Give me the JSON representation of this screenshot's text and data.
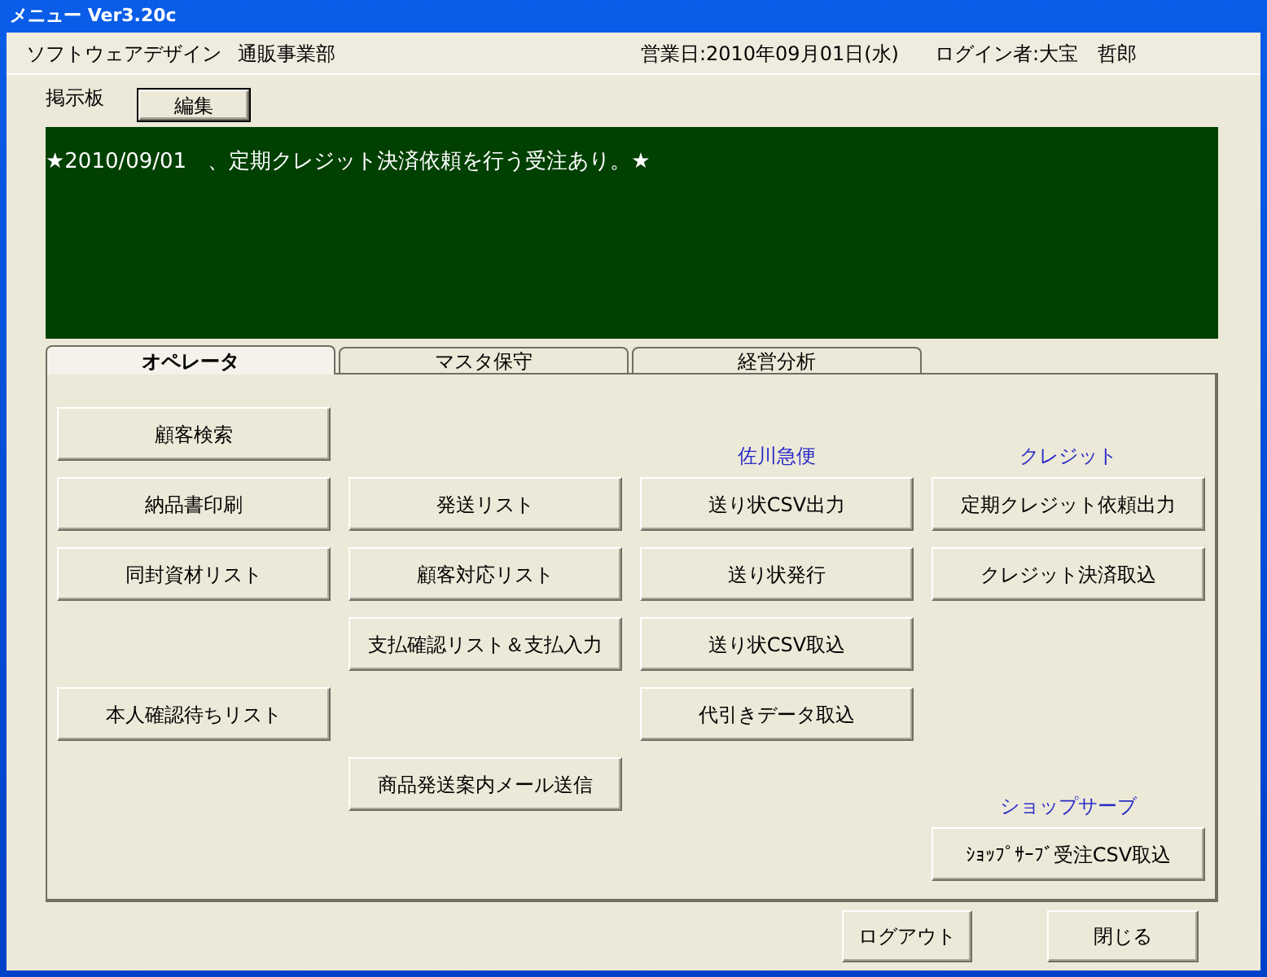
{
  "window": {
    "title": "メニュー Ver3.20c"
  },
  "header": {
    "company": "ソフトウェアデザイン",
    "department": "通販事業部",
    "business_date": "営業日:2010年09月01日(水)",
    "login_user": "ログイン者:大宝　哲郎"
  },
  "bulletin": {
    "label": "掲示板",
    "edit_button": "編集",
    "message": "★2010/09/01　、定期クレジット決済依頼を行う受注あり。★"
  },
  "tabs": [
    {
      "label": "オペレータ",
      "selected": true
    },
    {
      "label": "マスタ保守",
      "selected": false
    },
    {
      "label": "経営分析",
      "selected": false
    }
  ],
  "grid_rows": [
    [
      {
        "kind": "button",
        "label": "顧客検索"
      },
      null,
      {
        "kind": "heading",
        "label": "佐川急便"
      },
      {
        "kind": "heading",
        "label": "クレジット"
      }
    ],
    [
      {
        "kind": "button",
        "label": "納品書印刷"
      },
      {
        "kind": "button",
        "label": "発送リスト"
      },
      {
        "kind": "button",
        "label": "送り状CSV出力"
      },
      {
        "kind": "button",
        "label": "定期クレジット依頼出力"
      }
    ],
    [
      {
        "kind": "button",
        "label": "同封資材リスト"
      },
      {
        "kind": "button",
        "label": "顧客対応リスト"
      },
      {
        "kind": "button",
        "label": "送り状発行"
      },
      {
        "kind": "button",
        "label": "クレジット決済取込"
      }
    ],
    [
      null,
      {
        "kind": "button",
        "label": "支払確認リスト＆支払入力"
      },
      {
        "kind": "button",
        "label": "送り状CSV取込"
      },
      null
    ],
    [
      {
        "kind": "button",
        "label": "本人確認待ちリスト"
      },
      null,
      {
        "kind": "button",
        "label": "代引きデータ取込"
      },
      null
    ],
    [
      null,
      {
        "kind": "button",
        "label": "商品発送案内メール送信"
      },
      null,
      {
        "kind": "heading",
        "label": "ショップサーブ"
      }
    ],
    [
      null,
      null,
      null,
      {
        "kind": "button",
        "label": "ｼｮｯﾌﾟｻｰﾌﾞ受注CSV取込"
      }
    ]
  ],
  "footer_buttons": [
    "ログアウト",
    "閉じる"
  ]
}
